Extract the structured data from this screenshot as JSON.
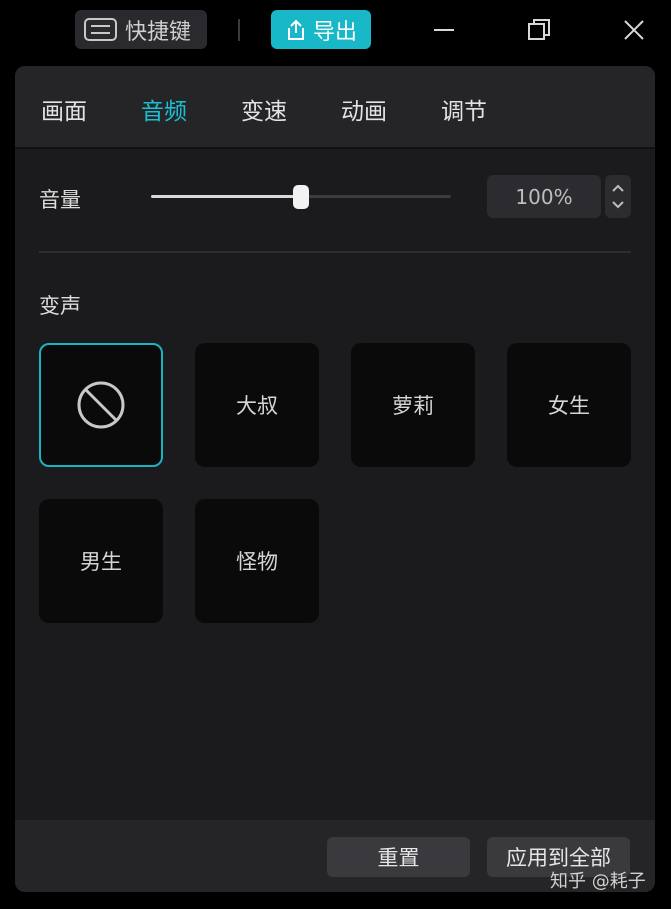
{
  "topbar": {
    "shortcut_label": "快捷键",
    "export_label": "导出",
    "icons": [
      "keyboard-icon",
      "export-icon",
      "minimize-icon",
      "restore-icon",
      "close-icon"
    ]
  },
  "tabs": [
    {
      "label": "画面",
      "active": false
    },
    {
      "label": "音频",
      "active": true
    },
    {
      "label": "变速",
      "active": false
    },
    {
      "label": "动画",
      "active": false
    },
    {
      "label": "调节",
      "active": false
    }
  ],
  "volume": {
    "label": "音量",
    "value_text": "100%",
    "slider_fraction": 0.5
  },
  "voice_change": {
    "label": "变声",
    "options": [
      {
        "label": "",
        "icon": "none-icon",
        "selected": true
      },
      {
        "label": "大叔",
        "selected": false
      },
      {
        "label": "萝莉",
        "selected": false
      },
      {
        "label": "女生",
        "selected": false
      },
      {
        "label": "男生",
        "selected": false
      },
      {
        "label": "怪物",
        "selected": false
      }
    ]
  },
  "footer": {
    "reset_label": "重置",
    "apply_all_label": "应用到全部"
  },
  "watermark": "知乎 @耗子",
  "colors": {
    "accent": "#19c0d4",
    "panel_bg": "#1b1b1d",
    "card_bg": "#0a0a0b"
  }
}
